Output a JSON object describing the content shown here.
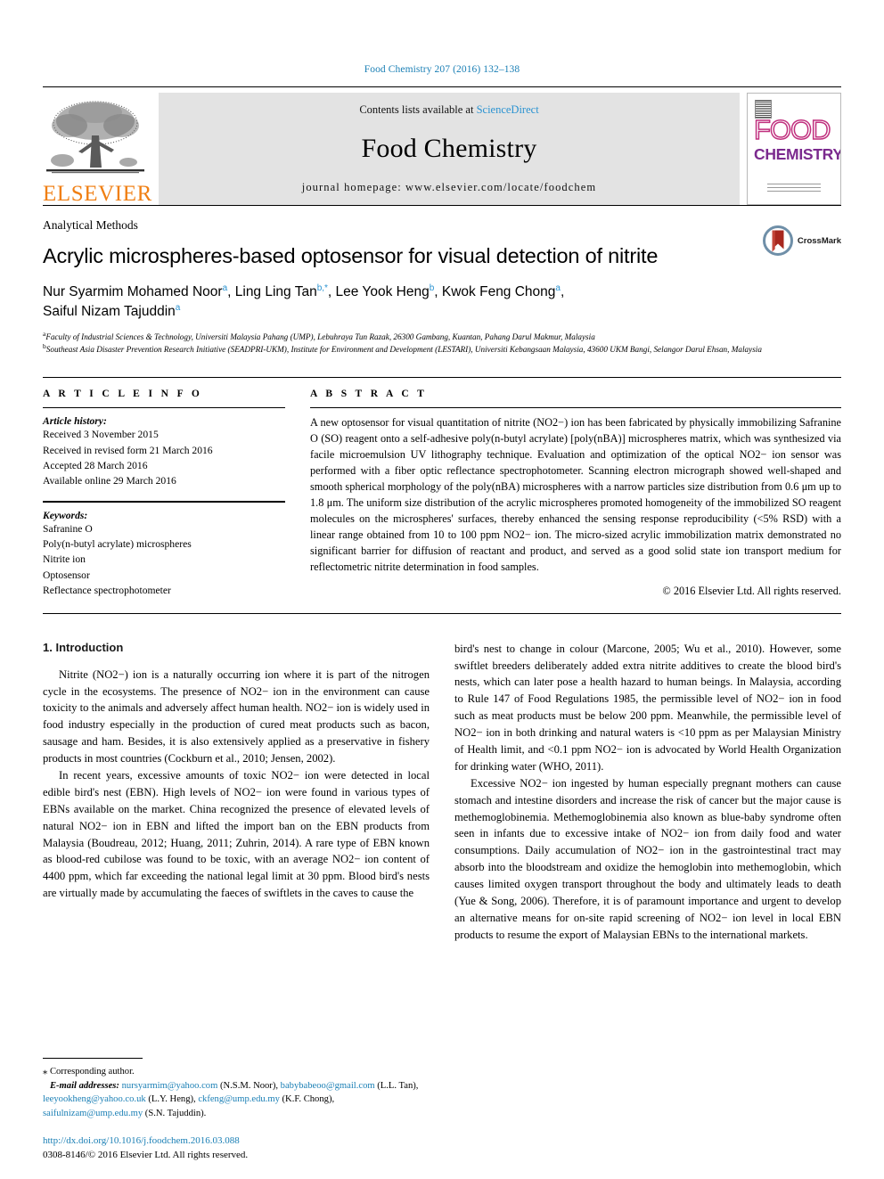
{
  "running_head": "Food Chemistry 207 (2016) 132–138",
  "masthead": {
    "contents_prefix": "Contents lists available at ",
    "sciencedirect": "ScienceDirect",
    "journal_name": "Food Chemistry",
    "homepage": "journal homepage: www.elsevier.com/locate/foodchem",
    "publisher": "ELSEVIER",
    "cover": {
      "line1": "FOOD",
      "line2": "CHEMISTRY"
    },
    "accent_sciencedirect": "#2b93d1",
    "accent_elsevier": "#f07f13",
    "cover_food_color": "#c0307e",
    "cover_chem_color": "#7b2a8e"
  },
  "article": {
    "kicker": "Analytical Methods",
    "title": "Acrylic microspheres-based optosensor for visual detection of nitrite",
    "crossmark_label": "CrossMark",
    "authors_line1": "Nur Syarmim Mohamed Noor a, Ling Ling Tan b,*, Lee Yook Heng b, Kwok Feng Chong a,",
    "authors_line2": "Saiful Nizam Tajuddin a",
    "authors": [
      {
        "name": "Nur Syarmim Mohamed Noor",
        "marks": "a"
      },
      {
        "name": "Ling Ling Tan",
        "marks": "b,*"
      },
      {
        "name": "Lee Yook Heng",
        "marks": "b"
      },
      {
        "name": "Kwok Feng Chong",
        "marks": "a"
      },
      {
        "name": "Saiful Nizam Tajuddin",
        "marks": "a"
      }
    ],
    "affiliations": [
      {
        "mark": "a",
        "text": "Faculty of Industrial Sciences & Technology, Universiti Malaysia Pahang (UMP), Lebuhraya Tun Razak, 26300 Gambang, Kuantan, Pahang Darul Makmur, Malaysia"
      },
      {
        "mark": "b",
        "text": "Southeast Asia Disaster Prevention Research Initiative (SEADPRI-UKM), Institute for Environment and Development (LESTARI), Universiti Kebangsaan Malaysia, 43600 UKM Bangi, Selangor Darul Ehsan, Malaysia"
      }
    ]
  },
  "article_info": {
    "heading": "A R T I C L E   I N F O",
    "history_title": "Article history:",
    "history": [
      "Received 3 November 2015",
      "Received in revised form 21 March 2016",
      "Accepted 28 March 2016",
      "Available online 29 March 2016"
    ],
    "keywords_title": "Keywords:",
    "keywords": [
      "Safranine O",
      "Poly(n-butyl acrylate) microspheres",
      "Nitrite ion",
      "Optosensor",
      "Reflectance spectrophotometer"
    ]
  },
  "abstract": {
    "heading": "A B S T R A C T",
    "text": "A new optosensor for visual quantitation of nitrite (NO2−) ion has been fabricated by physically immobilizing Safranine O (SO) reagent onto a self-adhesive poly(n-butyl acrylate) [poly(nBA)] microspheres matrix, which was synthesized via facile microemulsion UV lithography technique. Evaluation and optimization of the optical NO2− ion sensor was performed with a fiber optic reflectance spectrophotometer. Scanning electron micrograph showed well-shaped and smooth spherical morphology of the poly(nBA) microspheres with a narrow particles size distribution from 0.6 μm up to 1.8 μm. The uniform size distribution of the acrylic microspheres promoted homogeneity of the immobilized SO reagent molecules on the microspheres' surfaces, thereby enhanced the sensing response reproducibility (<5% RSD) with a linear range obtained from 10 to 100 ppm NO2− ion. The micro-sized acrylic immobilization matrix demonstrated no significant barrier for diffusion of reactant and product, and served as a good solid state ion transport medium for reflectometric nitrite determination in food samples.",
    "copyright": "© 2016 Elsevier Ltd. All rights reserved."
  },
  "body": {
    "intro_heading": "1. Introduction",
    "left_paragraphs": [
      "Nitrite (NO2−) ion is a naturally occurring ion where it is part of the nitrogen cycle in the ecosystems. The presence of NO2− ion in the environment can cause toxicity to the animals and adversely affect human health. NO2− ion is widely used in food industry especially in the production of cured meat products such as bacon, sausage and ham. Besides, it is also extensively applied as a preservative in fishery products in most countries (Cockburn et al., 2010; Jensen, 2002).",
      "In recent years, excessive amounts of toxic NO2− ion were detected in local edible bird's nest (EBN). High levels of NO2− ion were found in various types of EBNs available on the market. China recognized the presence of elevated levels of natural NO2− ion in EBN and lifted the import ban on the EBN products from Malaysia (Boudreau, 2012; Huang, 2011; Zuhrin, 2014). A rare type of EBN known as blood-red cubilose was found to be toxic, with an average NO2− ion content of 4400 ppm, which far exceeding the national legal limit at 30 ppm. Blood bird's nests are virtually made by accumulating the faeces of swiftlets in the caves to cause the"
    ],
    "right_paragraphs": [
      "bird's nest to change in colour (Marcone, 2005; Wu et al., 2010). However, some swiftlet breeders deliberately added extra nitrite additives to create the blood bird's nests, which can later pose a health hazard to human beings. In Malaysia, according to Rule 147 of Food Regulations 1985, the permissible level of NO2− ion in food such as meat products must be below 200 ppm. Meanwhile, the permissible level of NO2− ion in both drinking and natural waters is <10 ppm as per Malaysian Ministry of Health limit, and <0.1 ppm NO2− ion is advocated by World Health Organization for drinking water (WHO, 2011).",
      "Excessive NO2− ion ingested by human especially pregnant mothers can cause stomach and intestine disorders and increase the risk of cancer but the major cause is methemoglobinemia. Methemoglobinemia also known as blue-baby syndrome often seen in infants due to excessive intake of NO2− ion from daily food and water consumptions. Daily accumulation of NO2− ion in the gastrointestinal tract may absorb into the bloodstream and oxidize the hemoglobin into methemoglobin, which causes limited oxygen transport throughout the body and ultimately leads to death (Yue & Song, 2006). Therefore, it is of paramount importance and urgent to develop an alternative means for on-site rapid screening of NO2− ion level in local EBN products to resume the export of Malaysian EBNs to the international markets."
    ],
    "citations_left": [
      "Cockburn et al., 2010;",
      "Jensen, 2002",
      "Boudreau, 2012; Huang, 2011; Zuhrin, 2014"
    ],
    "citations_right": [
      "Marcone, 2005; Wu et al., 2010",
      "Food Regulations 1985",
      "WHO, 2011",
      "Yue & Song, 2006"
    ]
  },
  "footnote": {
    "corresponding": "⁎ Corresponding author.",
    "email_label": "E-mail addresses:",
    "emails": [
      {
        "address": "nursyarmim@yahoo.com",
        "owner": "(N.S.M. Noor)"
      },
      {
        "address": "babybabeoo@gmail.com",
        "owner": "(L.L. Tan)"
      },
      {
        "address": "leeyookheng@yahoo.co.uk",
        "owner": "(L.Y. Heng)"
      },
      {
        "address": "ckfeng@ump.edu.my",
        "owner": "(K.F. Chong)"
      },
      {
        "address": "saifulnizam@ump.edu.my",
        "owner": "(S.N. Tajuddin)"
      }
    ],
    "doi": "http://dx.doi.org/10.1016/j.foodchem.2016.03.088",
    "issn": "0308-8146/© 2016 Elsevier Ltd. All rights reserved."
  }
}
